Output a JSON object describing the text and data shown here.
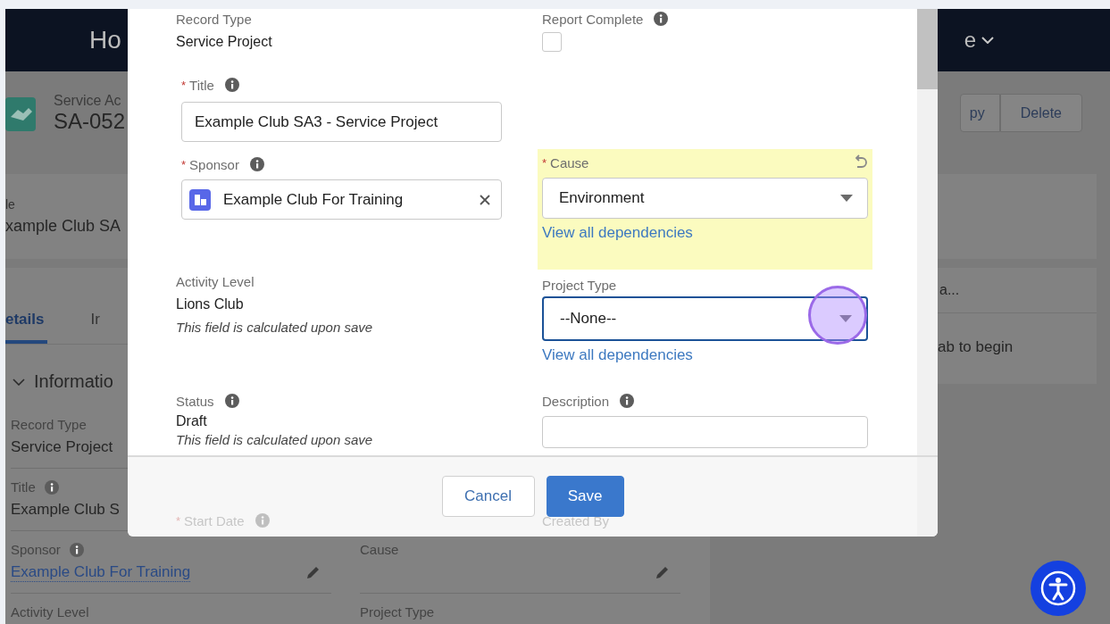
{
  "background_page": {
    "nav": {
      "left_text": "Ho",
      "right_text": "e"
    },
    "record": {
      "object_label": "Service Ac",
      "record_name": "SA-052",
      "actions": [
        "py",
        "Delete"
      ]
    },
    "highlights": {
      "label": "le",
      "value": "xample Club SA"
    },
    "tabs": [
      {
        "label": "etails",
        "selected": true
      },
      {
        "label": "Ir",
        "selected": false
      }
    ],
    "section": {
      "title": "Informatio",
      "expanded": true
    },
    "left_fields": [
      {
        "label": "Record Type",
        "value": "Service Project",
        "info": false,
        "kind": "text"
      },
      {
        "label": "Title",
        "value": "Example Club S",
        "info": true,
        "editable": false,
        "kind": "text"
      },
      {
        "label": "Sponsor",
        "value": "Example Club For Training",
        "info": true,
        "editable": true,
        "kind": "link"
      },
      {
        "label": "Activity Level",
        "info": false
      }
    ],
    "right_fields": [
      {
        "label": "Cause",
        "info": false,
        "editable": true
      },
      {
        "label": "Project Type",
        "info": false
      }
    ],
    "sidebar": {
      "tab_label": "a...",
      "message": "ab to begin"
    }
  },
  "modal": {
    "rows": [
      {
        "left": {
          "kind": "readonly",
          "label": "Record Type",
          "value": "Service Project",
          "info": false
        },
        "right": {
          "kind": "checkbox",
          "label": "Report Complete",
          "info": true,
          "checked": false
        }
      },
      {
        "left": {
          "kind": "input",
          "label": "Title",
          "required_mark": "*",
          "info": true,
          "value": "Example Club SA3 - Service Project"
        }
      },
      {
        "left": {
          "kind": "lookup",
          "label": "Sponsor",
          "required_mark": "*",
          "info": true,
          "value": "Example Club For Training"
        },
        "right": {
          "kind": "picklist",
          "label": "Cause",
          "required_mark": "*",
          "info": false,
          "value": "Environment",
          "link": "View all dependencies",
          "changed": true,
          "focused": false
        }
      },
      {
        "left": {
          "kind": "readonly",
          "label": "Activity Level",
          "value": "Lions Club",
          "note": "This field is calculated upon save",
          "info": false
        },
        "right": {
          "kind": "picklist",
          "label": "Project Type",
          "info": false,
          "value": "--None--",
          "link": "View all dependencies",
          "changed": false,
          "focused": true
        }
      },
      {
        "left": {
          "kind": "readonly",
          "label": "Status",
          "value": "Draft",
          "note": "This field is calculated upon save",
          "info": true
        },
        "right": {
          "kind": "textarea",
          "label": "Description",
          "info": true
        }
      },
      {
        "left": {
          "kind": "label_only",
          "label": "Start Date",
          "required_mark": "*",
          "info": true
        },
        "right": {
          "kind": "label_only",
          "label": "Created By",
          "info": false
        }
      }
    ],
    "buttons": [
      {
        "label": "Cancel",
        "kind": "neutral"
      },
      {
        "label": "Save",
        "kind": "brand"
      }
    ]
  }
}
